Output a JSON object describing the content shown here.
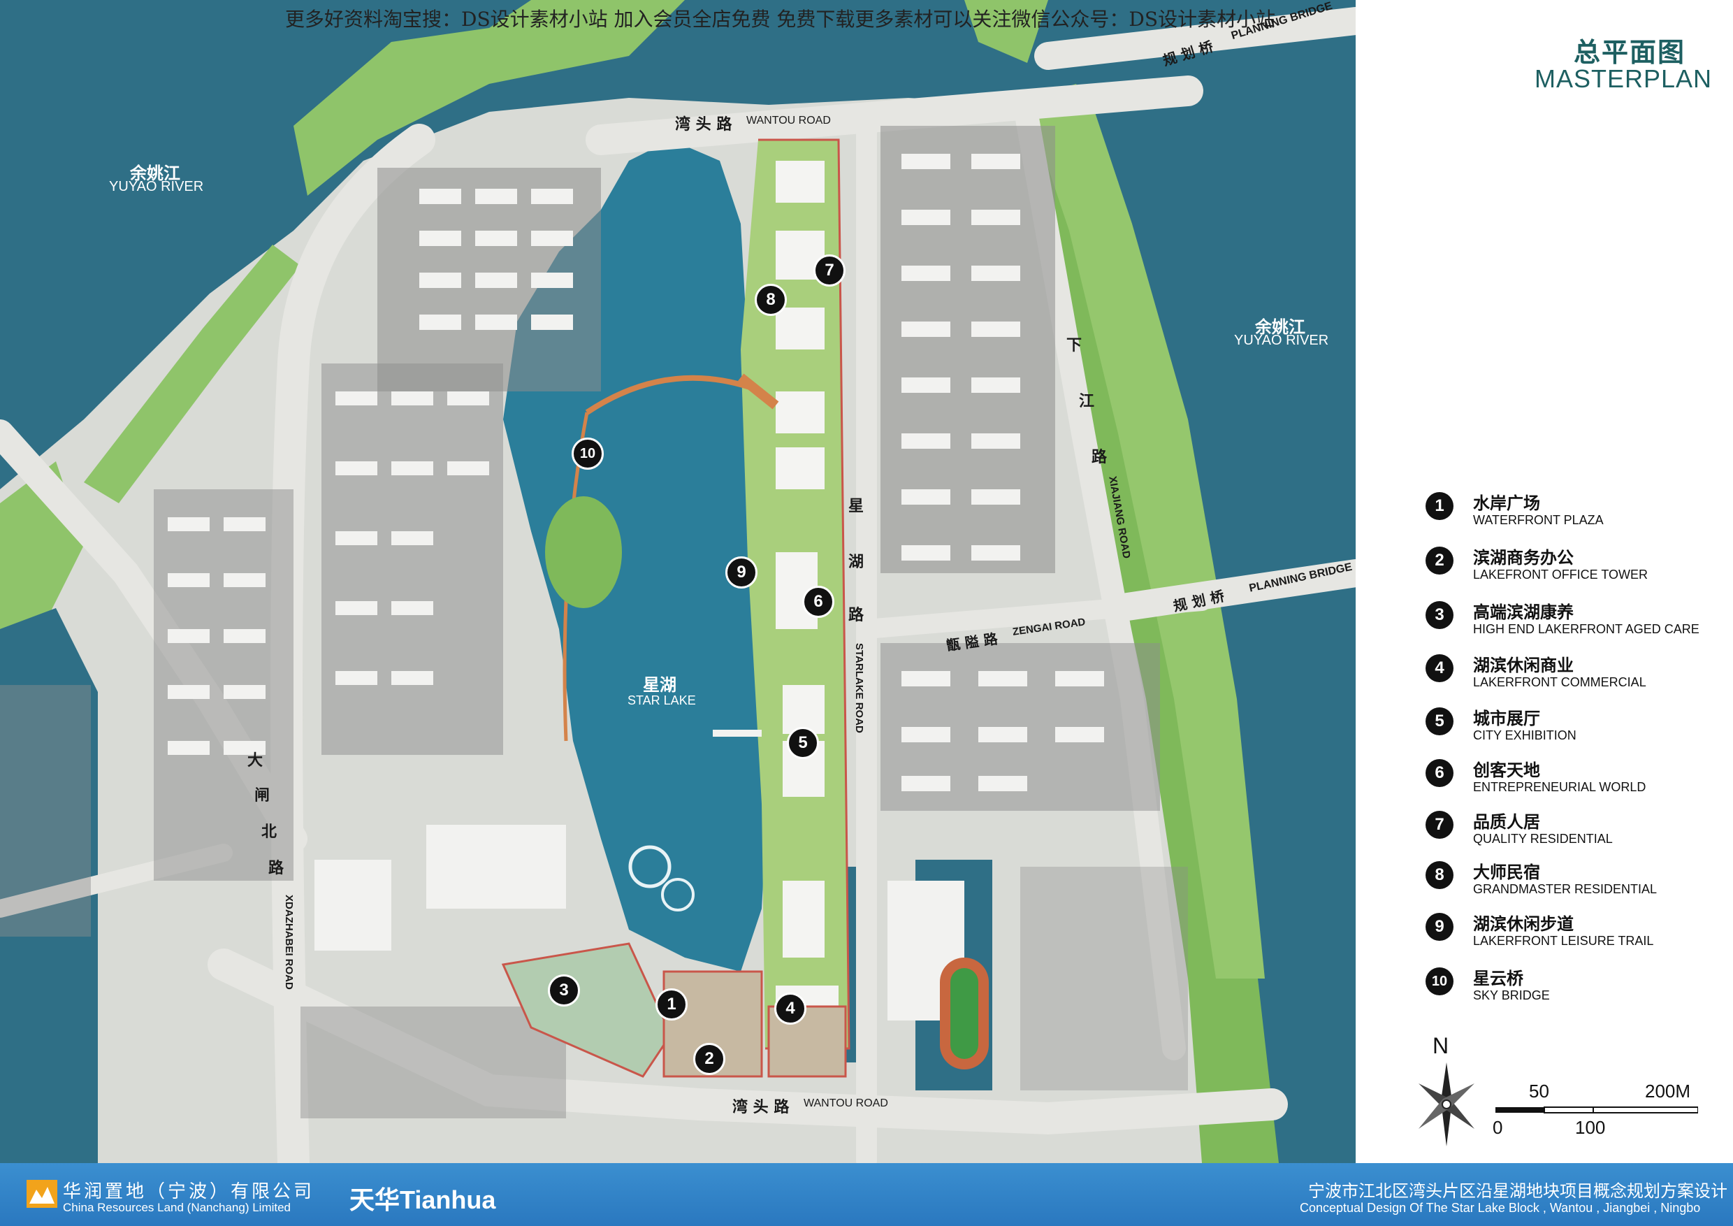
{
  "watermark": "更多好资料淘宝搜：DS设计素材小站 加入会员全店免费 免费下载更多素材可以关注微信公众号：DS设计素材小站",
  "title": {
    "cn": "总平面图",
    "en": "MASTERPLAN"
  },
  "map_labels": {
    "yuyao_river_left_cn": "余姚江",
    "yuyao_river_left_en": "YUYAO RIVER",
    "yuyao_river_right_cn": "余姚江",
    "yuyao_river_right_en": "YUYAO RIVER",
    "planning_bridge_top_cn": "规 划 桥",
    "planning_bridge_top_en": "PLANNING BRIDGE",
    "planning_bridge_mid_cn": "规 划 桥",
    "planning_bridge_mid_en": "PLANNING BRIDGE",
    "wantou_road_top_cn": "湾 头 路",
    "wantou_road_top_en": "WANTOU ROAD",
    "wantou_road_bottom_cn": "湾 头 路",
    "wantou_road_bottom_en": "WANTOU ROAD",
    "xiajiang_road_cn": [
      "下",
      "江",
      "路"
    ],
    "xiajiang_road_en": "XIAJIANG ROAD",
    "starlake_road_cn": [
      "星",
      "湖",
      "路"
    ],
    "starlake_road_en": "STARLAKE ROAD",
    "zengai_road_cn": "甑 隘 路",
    "zengai_road_en": "ZENGAI ROAD",
    "dazhabei_road_cn": [
      "大",
      "闸",
      "北",
      "路"
    ],
    "dazhabei_road_en": "XDAZHABEI ROAD",
    "star_lake_cn": "星湖",
    "star_lake_en": "STAR LAKE"
  },
  "markers": [
    "1",
    "2",
    "3",
    "4",
    "5",
    "6",
    "7",
    "8",
    "9",
    "10"
  ],
  "legend": [
    {
      "num": "1",
      "cn": "水岸广场",
      "en": "WATERFRONT PLAZA"
    },
    {
      "num": "2",
      "cn": "滨湖商务办公",
      "en": "LAKEFRONT OFFICE TOWER"
    },
    {
      "num": "3",
      "cn": "高端滨湖康养",
      "en": "HIGH END LAKERFRONT AGED CARE"
    },
    {
      "num": "4",
      "cn": "湖滨休闲商业",
      "en": "LAKERFRONT COMMERCIAL"
    },
    {
      "num": "5",
      "cn": "城市展厅",
      "en": "CITY EXHIBITION"
    },
    {
      "num": "6",
      "cn": "创客天地",
      "en": "ENTREPRENEURIAL WORLD"
    },
    {
      "num": "7",
      "cn": "品质人居",
      "en": "QUALITY RESIDENTIAL"
    },
    {
      "num": "8",
      "cn": "大师民宿",
      "en": "GRANDMASTER RESIDENTIAL"
    },
    {
      "num": "9",
      "cn": "湖滨休闲步道",
      "en": "LAKERFRONT LEISURE TRAIL"
    },
    {
      "num": "10",
      "cn": "星云桥",
      "en": "SKY BRIDGE"
    }
  ],
  "compass": {
    "label": "N"
  },
  "scale": {
    "top_left": "50",
    "top_right": "200M",
    "bottom_left": "0",
    "bottom_mid": "100"
  },
  "footer": {
    "company_cn": "华润置地（宁波）有限公司",
    "company_en": "China Resources Land (Nanchang) Limited",
    "partner": "天华Tianhua",
    "project_cn": "宁波市江北区湾头片区沿星湖地块项目概念规划方案设计",
    "project_en": "Conceptual Design Of The Star Lake Block , Wantou , Jiangbei , Ningbo"
  },
  "colors": {
    "water": "#2f6f86",
    "green": "#8fc46a",
    "road": "#dcdcdc",
    "footer": "#2a78bf",
    "accent": "#1d5f61"
  }
}
